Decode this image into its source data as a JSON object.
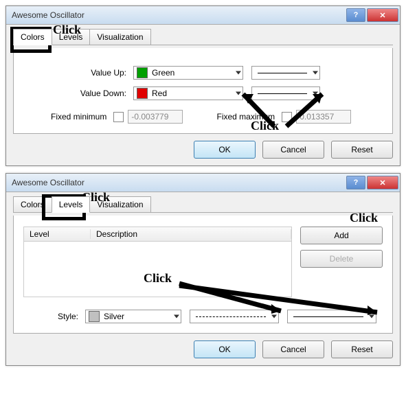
{
  "dialog1": {
    "title": "Awesome Oscillator",
    "tabs": [
      "Colors",
      "Levels",
      "Visualization"
    ],
    "activeTab": 0,
    "rows": {
      "up_label": "Value Up:",
      "up_color_name": "Green",
      "up_color_hex": "#00a000",
      "down_label": "Value Down:",
      "down_color_name": "Red",
      "down_color_hex": "#e00000"
    },
    "fixed_min_label": "Fixed minimum",
    "fixed_min_value": "-0.003779",
    "fixed_max_label": "Fixed maximum",
    "fixed_max_value": "0.013357",
    "ok": "OK",
    "cancel": "Cancel",
    "reset": "Reset"
  },
  "dialog2": {
    "title": "Awesome Oscillator",
    "tabs": [
      "Colors",
      "Levels",
      "Visualization"
    ],
    "activeTab": 1,
    "table": {
      "col_level": "Level",
      "col_desc": "Description"
    },
    "add": "Add",
    "delete": "Delete",
    "style_label": "Style:",
    "style_color_name": "Silver",
    "style_color_hex": "#c0c0c0",
    "ok": "OK",
    "cancel": "Cancel",
    "reset": "Reset"
  },
  "annotations": {
    "click": "Click"
  }
}
